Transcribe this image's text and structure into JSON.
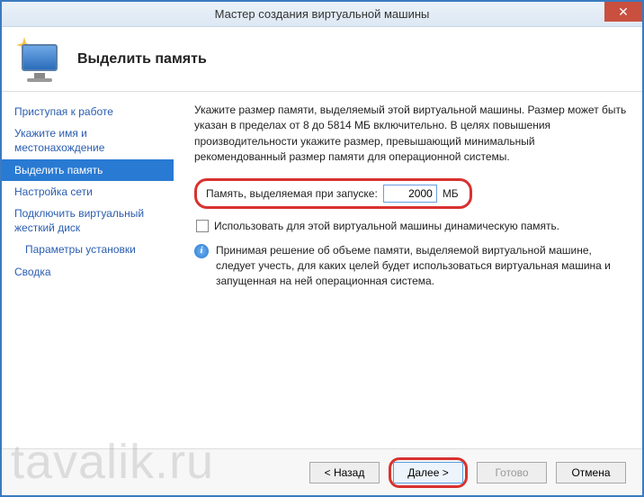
{
  "window": {
    "title": "Мастер создания виртуальной машины",
    "close_glyph": "✕"
  },
  "header": {
    "title": "Выделить память"
  },
  "sidebar": {
    "items": [
      {
        "label": "Приступая к работе"
      },
      {
        "label": "Укажите имя и местонахождение"
      },
      {
        "label": "Выделить память"
      },
      {
        "label": "Настройка сети"
      },
      {
        "label": "Подключить виртуальный жесткий диск"
      },
      {
        "label": "Параметры установки"
      },
      {
        "label": "Сводка"
      }
    ],
    "selected_index": 2
  },
  "content": {
    "description": "Укажите размер памяти, выделяемый этой виртуальной машины. Размер может быть указан в пределах от 8 до 5814 МБ включительно. В целях повышения производительности укажите размер, превышающий минимальный рекомендованный размер памяти для операционной системы.",
    "memory_label": "Память, выделяемая при запуске:",
    "memory_value": "2000",
    "memory_unit": "МБ",
    "dynamic_checkbox_label": "Использовать для этой виртуальной машины динамическую память.",
    "dynamic_checked": false,
    "info_text": "Принимая решение об объеме памяти, выделяемой виртуальной машине, следует учесть, для каких целей будет использоваться виртуальная машина и запущенная на ней операционная система.",
    "info_glyph": "i"
  },
  "footer": {
    "back": "< Назад",
    "next": "Далее >",
    "finish": "Готово",
    "cancel": "Отмена"
  },
  "watermark": "tavalik.ru"
}
